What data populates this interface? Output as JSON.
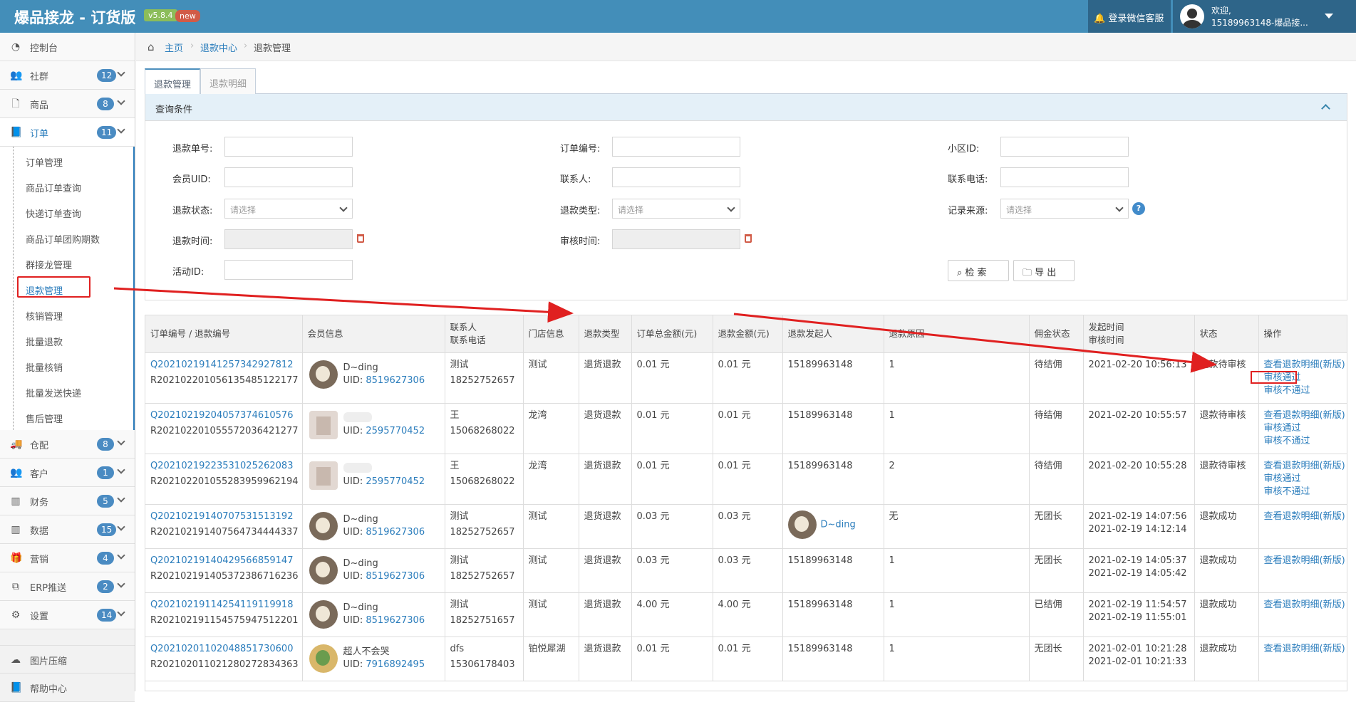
{
  "app": {
    "title": "爆品接龙 - 订货版",
    "version": "v5.8.4",
    "new_badge": "new"
  },
  "header": {
    "service_label": "登录微信客服",
    "welcome": "欢迎,",
    "user": "15189963148-爆品接..."
  },
  "sidebar": {
    "items": [
      {
        "label": "控制台",
        "icon": "dashboard-icon"
      },
      {
        "label": "社群",
        "badge": "12",
        "icon": "users-icon"
      },
      {
        "label": "商品",
        "badge": "8",
        "icon": "file-icon"
      },
      {
        "label": "订单",
        "badge": "11",
        "icon": "book-icon"
      },
      {
        "label": "仓配",
        "badge": "8",
        "icon": "truck-icon"
      },
      {
        "label": "客户",
        "badge": "1",
        "icon": "users-icon"
      },
      {
        "label": "财务",
        "badge": "5",
        "icon": "bar-chart-icon"
      },
      {
        "label": "数据",
        "badge": "15",
        "icon": "bar-chart-icon"
      },
      {
        "label": "营销",
        "badge": "4",
        "icon": "gift-icon"
      },
      {
        "label": "ERP推送",
        "badge": "2",
        "icon": "clone-icon"
      },
      {
        "label": "设置",
        "badge": "14",
        "icon": "cogs-icon"
      },
      {
        "label": "图片压缩",
        "icon": "cloud-upload-icon"
      },
      {
        "label": "帮助中心",
        "icon": "book-icon"
      }
    ],
    "sub_items": [
      "订单管理",
      "商品订单查询",
      "快递订单查询",
      "商品订单团购期数",
      "群接龙管理",
      "退款管理",
      "核销管理",
      "批量退款",
      "批量核销",
      "批量发送快递",
      "售后管理"
    ],
    "collapse_label": "«"
  },
  "breadcrumb": {
    "home": "主页",
    "level2": "退款中心",
    "current": "退款管理",
    "sep": "›"
  },
  "tabs": [
    "退款管理",
    "退款明细"
  ],
  "filter": {
    "title": "查询条件",
    "labels": {
      "refund_no": "退款单号:",
      "order_no": "订单编号:",
      "community_id": "小区ID:",
      "member_uid": "会员UID:",
      "contact": "联系人:",
      "phone": "联系电话:",
      "refund_status": "退款状态:",
      "refund_type": "退款类型:",
      "source": "记录来源:",
      "refund_time": "退款时间:",
      "audit_time": "审核时间:",
      "activity_id": "活动ID:"
    },
    "select_placeholder": "请选择",
    "search_btn": "检 索",
    "export_btn": "导 出",
    "help": "?"
  },
  "table": {
    "headers": [
      "订单编号 / 退款编号",
      "会员信息",
      "联系人",
      "联系电话",
      "门店信息",
      "退款类型",
      "订单总金额(元)",
      "退款金额(元)",
      "退款发起人",
      "退款原因",
      "佣金状态",
      "发起时间",
      "审核时间",
      "状态",
      "操作"
    ],
    "ops": {
      "view": "查看退款明细(新版)",
      "approve": "审核通过",
      "reject": "审核不通过"
    },
    "rows": [
      {
        "order": "Q20210219141257342927812",
        "refund": "R20210220105613548512217​7",
        "name": "D~ding",
        "uid_label": "UID:",
        "uid": "8519627306",
        "contact": "测试",
        "phone": "18252752657",
        "store": "测试",
        "type": "退货退款",
        "total": "0.01 元",
        "amount": "0.01 元",
        "initiator": "15189963148",
        "reason": "1",
        "commission": "待结佣",
        "time1": "2021-02-20 10:56:13",
        "time2": "",
        "status": "退款待审核",
        "ops": 3
      },
      {
        "order": "Q20210219204057374610576",
        "refund": "R20210220105557203642127​7",
        "name": "",
        "uid_label": "UID:",
        "uid": "2595770452",
        "contact": "王",
        "phone": "15068268022",
        "store": "龙湾",
        "type": "退货退款",
        "total": "0.01 元",
        "amount": "0.01 元",
        "initiator": "15189963148",
        "reason": "1",
        "commission": "待结佣",
        "time1": "2021-02-20 10:55:57",
        "time2": "",
        "status": "退款待审核",
        "ops": 3
      },
      {
        "order": "Q20210219223531025262083",
        "refund": "R20210220105528395996219​4",
        "name": "",
        "uid_label": "UID:",
        "uid": "2595770452",
        "contact": "王",
        "phone": "15068268022",
        "store": "龙湾",
        "type": "退货退款",
        "total": "0.01 元",
        "amount": "0.01 元",
        "initiator": "15189963148",
        "reason": "2",
        "commission": "待结佣",
        "time1": "2021-02-20 10:55:28",
        "time2": "",
        "status": "退款待审核",
        "ops": 3
      },
      {
        "order": "Q20210219140707531513192",
        "refund": "R20210219140756473444433​7",
        "name": "D~ding",
        "uid_label": "UID:",
        "uid": "8519627306",
        "contact": "测试",
        "phone": "18252752657",
        "store": "测试",
        "type": "退货退款",
        "total": "0.03 元",
        "amount": "0.03 元",
        "initiator": "D~ding",
        "reason": "无",
        "commission": "无团长",
        "time1": "2021-02-19 14:07:56",
        "time2": "2021-02-19 14:12:14",
        "status": "退款成功",
        "ops": 1
      },
      {
        "order": "Q20210219140429566859147",
        "refund": "R20210219140537238671623​6",
        "name": "D~ding",
        "uid_label": "UID:",
        "uid": "8519627306",
        "contact": "测试",
        "phone": "18252752657",
        "store": "测试",
        "type": "退货退款",
        "total": "0.03 元",
        "amount": "0.03 元",
        "initiator": "15189963148",
        "reason": "1",
        "commission": "无团长",
        "time1": "2021-02-19 14:05:37",
        "time2": "2021-02-19 14:05:42",
        "status": "退款成功",
        "ops": 1
      },
      {
        "order": "Q20210219114254119119918",
        "refund": "R20210219115457594751220​1",
        "name": "D~ding",
        "uid_label": "UID:",
        "uid": "8519627306",
        "contact": "测试",
        "phone": "18252751657",
        "store": "测试",
        "type": "退货退款",
        "total": "4.00 元",
        "amount": "4.00 元",
        "initiator": "15189963148",
        "reason": "1",
        "commission": "已结佣",
        "time1": "2021-02-19 11:54:57",
        "time2": "2021-02-19 11:55:01",
        "status": "退款成功",
        "ops": 1
      },
      {
        "order": "Q20210201102048851730600",
        "refund": "R20210201102128027283436​3",
        "name": "超人不会哭",
        "uid_label": "UID:",
        "uid": "7916892495",
        "contact": "dfs",
        "phone": "15306178403",
        "store": "铂悦犀湖",
        "type": "退货退款",
        "total": "0.01 元",
        "amount": "0.01 元",
        "initiator": "15189963148",
        "reason": "1",
        "commission": "无团长",
        "time1": "2021-02-01 10:21:28",
        "time2": "2021-02-01 10:21:33",
        "status": "退款成功",
        "ops": 1
      }
    ]
  }
}
